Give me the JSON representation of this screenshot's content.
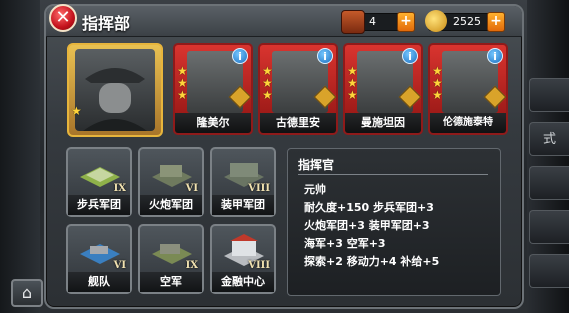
{
  "window": {
    "title": "指挥部",
    "close_icon": "✕",
    "home_icon": "⌂"
  },
  "resources": [
    {
      "name": "ammo-crate",
      "value": "4",
      "plus": "+"
    },
    {
      "name": "gold-medal",
      "value": "2525",
      "plus": "+"
    }
  ],
  "side_tabs": [
    "",
    "式",
    "",
    "",
    ""
  ],
  "generals": [
    {
      "name": "隆美尔",
      "info": "i"
    },
    {
      "name": "古德里安",
      "info": "i"
    },
    {
      "name": "曼施坦因",
      "info": "i"
    },
    {
      "name": "伦德施泰特",
      "info": "i"
    }
  ],
  "buildings": [
    {
      "label": "步兵军团",
      "level": "IX"
    },
    {
      "label": "火炮军团",
      "level": "VI"
    },
    {
      "label": "装甲军团",
      "level": "VIII"
    },
    {
      "label": "舰队",
      "level": "VI"
    },
    {
      "label": "空军",
      "level": "IX"
    },
    {
      "label": "金融中心",
      "level": "VIII"
    }
  ],
  "description": {
    "heading": "指挥官",
    "lines": [
      "元帅",
      "耐久度+150 步兵军团+3",
      "火炮军团+3 装甲军团+3",
      "海军+3 空军+3",
      "探索+2 移动力+4 补给+5"
    ]
  },
  "colors": {
    "accent_red": "#c3121c",
    "gold_frame": "#e7b53c",
    "plus_orange": "#f08a16",
    "info_blue": "#1d6fbf"
  }
}
